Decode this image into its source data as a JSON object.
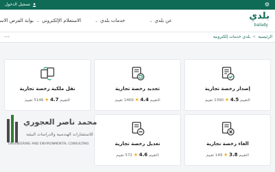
{
  "topbar": {
    "login_label": "تسجيل الدخول",
    "settings_icon": "gear-icon",
    "color": "#0f6b55"
  },
  "header": {
    "logo_ar": "بلدي",
    "logo_en": "balady",
    "nav": [
      "عن بلدي",
      "خدمات بلدي",
      "الاستعلام الإلكتروني",
      "بوابة الفرص الاستثمارية"
    ]
  },
  "breadcrumb": {
    "root": "الرئيسية",
    "current": "بلدي خدمات إلكترونية"
  },
  "rating_label": "التقييم",
  "count_suffix": "تقييم",
  "cards": [
    {
      "title": "إصدار رخصة تجارية",
      "score": "4.5",
      "count": "1390",
      "icon": "license-check-icon"
    },
    {
      "title": "تجديد رخصة تجارية",
      "score": "4.4",
      "count": "1469",
      "icon": "license-renew-icon"
    },
    {
      "title": "نقل ملكية رخصة تجارية",
      "score": "4.7",
      "count": "5146",
      "icon": "transfer-ownership-icon"
    },
    {
      "title": "الغاء رخصة تجارية",
      "score": "3.8",
      "count": "149",
      "icon": "license-cancel-icon"
    },
    {
      "title": "تعديل رخصة تجارية",
      "score": "4.6",
      "count": "572",
      "icon": "license-edit-icon"
    }
  ],
  "watermark": {
    "line1": "محمد ناصر العجوري",
    "line2": "للاستشارات الهندسية والدراسات البيئية",
    "line3": "ENGINEERING AND ENVIRONMENTAL CONSULTING"
  }
}
